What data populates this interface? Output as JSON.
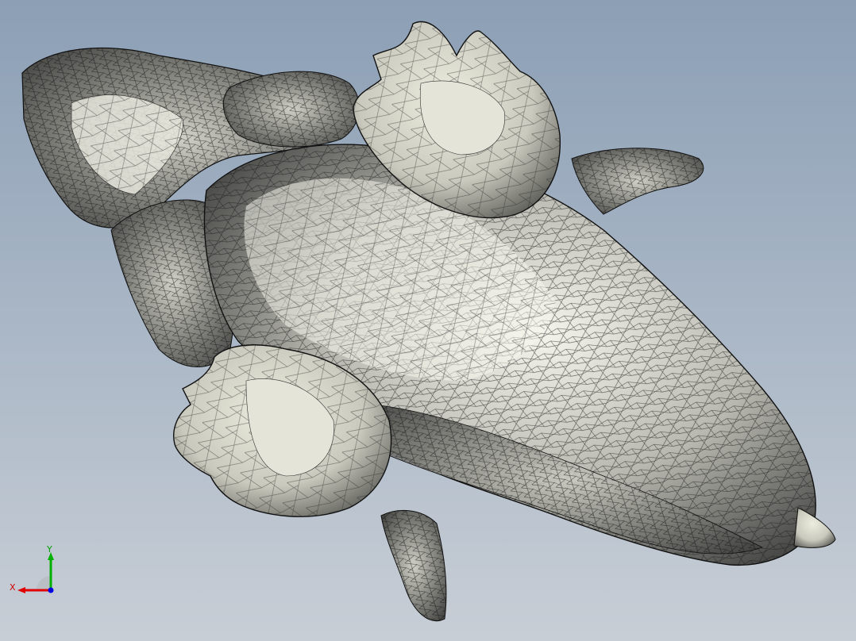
{
  "viewport": {
    "background_top": "#8c9fb5",
    "background_bottom": "#c8ced6"
  },
  "model": {
    "name_icon": "alligator-mesh-model",
    "render_mode": "shaded-with-edges",
    "fill_color": "#d9d9cf",
    "edge_color": "#1a1a1a"
  },
  "triad": {
    "x_label": "X",
    "y_label": "Y",
    "x_color": "#e00000",
    "y_color": "#00b000",
    "z_color": "#0000e0"
  }
}
